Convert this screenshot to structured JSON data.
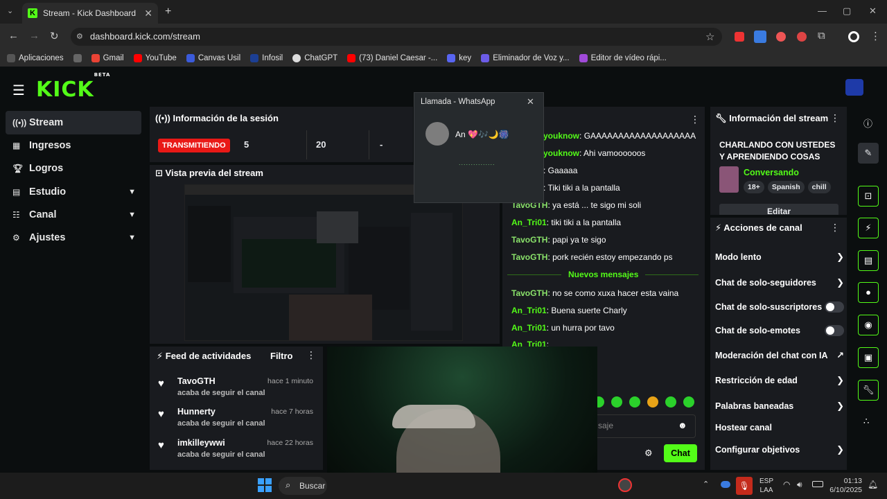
{
  "browser": {
    "tab_title": "Stream - Kick Dashboard",
    "url": "dashboard.kick.com/stream",
    "bookmarks": [
      "Aplicaciones",
      "Gmail",
      "YouTube",
      "Canvas Usil",
      "Infosil",
      "ChatGPT",
      "(73) Daniel Caesar -...",
      "key",
      "Eliminador de Voz y...",
      "Editor de vídeo rápi..."
    ]
  },
  "sidebar": {
    "items": [
      {
        "label": "Stream"
      },
      {
        "label": "Ingresos"
      },
      {
        "label": "Logros"
      },
      {
        "label": "Estudio"
      },
      {
        "label": "Canal"
      },
      {
        "label": "Ajustes"
      }
    ]
  },
  "session": {
    "title": "Información de la sesión",
    "status": "TRANSMITIENDO",
    "stat1": "5",
    "stat2": "20",
    "stat3": "-"
  },
  "preview": {
    "title": "Vista previa del stream"
  },
  "feed": {
    "title": "Feed de actividades",
    "filter": "Filtro",
    "items": [
      {
        "name": "TavoGTH",
        "time": "hace 1 minuto",
        "action": "acaba de seguir el canal"
      },
      {
        "name": "Hunnerty",
        "time": "hace 7 horas",
        "action": "acaba de seguir el canal"
      },
      {
        "name": "imkilleywwi",
        "time": "hace 22 horas",
        "action": "acaba de seguir el canal"
      }
    ]
  },
  "whatsapp": {
    "title": "Llamada - WhatsApp",
    "caller": "An 💖🎶🌙🎆",
    "dots": "..............."
  },
  "chat": {
    "lines": [
      {
        "user": "youknow",
        "text": "GAAAAAAAAAAAAAAAAAAA"
      },
      {
        "user": "youknow",
        "text": "Ahi vamoooooos"
      },
      {
        "user": "",
        "text": "Gaaaaa"
      },
      {
        "user": "",
        "text": "Tiki tiki a la pantalla"
      },
      {
        "user": "TavoGTH",
        "text": "ya está ... te sigo mi soli"
      },
      {
        "user": "An_Tri01",
        "text": "tiki tiki a la pantalla"
      },
      {
        "user": "TavoGTH",
        "text": "papi ya te sigo"
      },
      {
        "user": "TavoGTH",
        "text": "pork recién estoy empezando ps"
      }
    ],
    "new_messages": "Nuevos mensajes",
    "lines_after": [
      {
        "user": "TavoGTH",
        "text": "no se como xuxa hacer esta vaina"
      },
      {
        "user": "An_Tri01",
        "text": "Buena suerte Charly"
      },
      {
        "user": "An_Tri01",
        "text": "un hurra por tavo"
      },
      {
        "user": "An_Tri01",
        "text": ""
      }
    ],
    "input_placeholder": "saje",
    "send_label": "Chat"
  },
  "stream_info": {
    "title": "Información del stream",
    "stream_title": "CHARLANDO CON USTEDES Y APRENDIENDO COSAS",
    "category": "Conversando",
    "tags": [
      "18+",
      "Spanish",
      "chill"
    ],
    "edit": "Editar"
  },
  "channel_actions": {
    "title": "Acciones de canal",
    "items": [
      {
        "label": "Modo lento",
        "kind": "arrow"
      },
      {
        "label": "Chat de solo-seguidores",
        "kind": "arrow"
      },
      {
        "label": "Chat de solo-suscriptores",
        "kind": "toggle"
      },
      {
        "label": "Chat de solo-emotes",
        "kind": "toggle"
      },
      {
        "label": "Moderación del chat con IA",
        "kind": "external"
      },
      {
        "label": "Restricción de edad",
        "kind": "arrow"
      },
      {
        "label": "Palabras baneadas",
        "kind": "arrow"
      },
      {
        "label": "Hostear canal",
        "kind": "none"
      },
      {
        "label": "Configurar objetivos",
        "kind": "arrow"
      }
    ]
  },
  "taskbar": {
    "search": "Buscar",
    "lang": "ESP",
    "lang2": "LAA",
    "time": "01:13",
    "date": "6/10/2025"
  },
  "colors": {
    "kick_green": "#53fc18",
    "live_red": "#e91916"
  }
}
